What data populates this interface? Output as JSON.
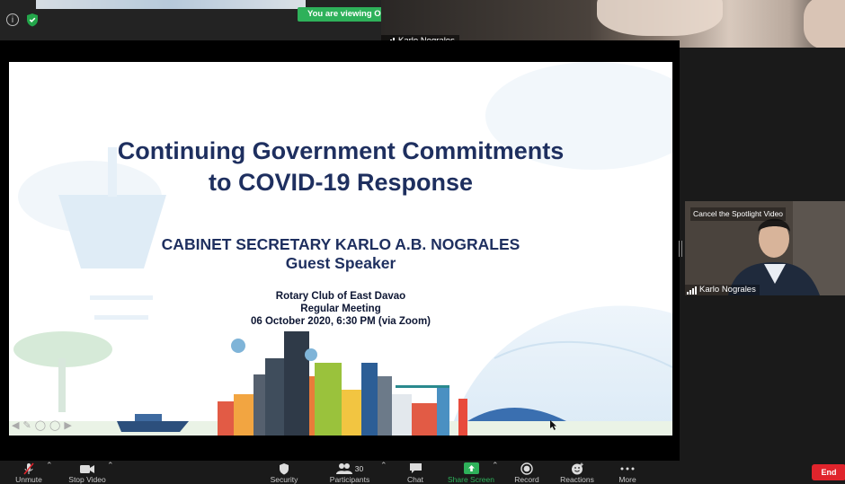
{
  "top_bar": {
    "viewing_banner": "You are viewing OCS's screen"
  },
  "top_video": {
    "participant_name": "Karlo Nograles"
  },
  "slide": {
    "title_line1": "Continuing Government Commitments",
    "title_line2": "to COVID-19 Response",
    "speaker_line1": "CABINET SECRETARY KARLO A.B. NOGRALES",
    "speaker_line2": "Guest Speaker",
    "event_line1": "Rotary Club of East Davao",
    "event_line2": "Regular Meeting",
    "event_line3": "06 October 2020, 6:30 PM (via Zoom)"
  },
  "speaker_video": {
    "spotlight_label": "Cancel the Spotlight Video",
    "participant_name": "Karlo Nograles"
  },
  "toolbar": {
    "unmute": "Unmute",
    "stop_video": "Stop Video",
    "security": "Security",
    "participants": "Participants",
    "participants_count": "30",
    "chat": "Chat",
    "share_screen": "Share Screen",
    "record": "Record",
    "reactions": "Reactions",
    "more": "More",
    "end": "End"
  },
  "colors": {
    "share_green": "#2eb15a",
    "end_red": "#e0242c",
    "title_navy": "#1e2f5f"
  }
}
